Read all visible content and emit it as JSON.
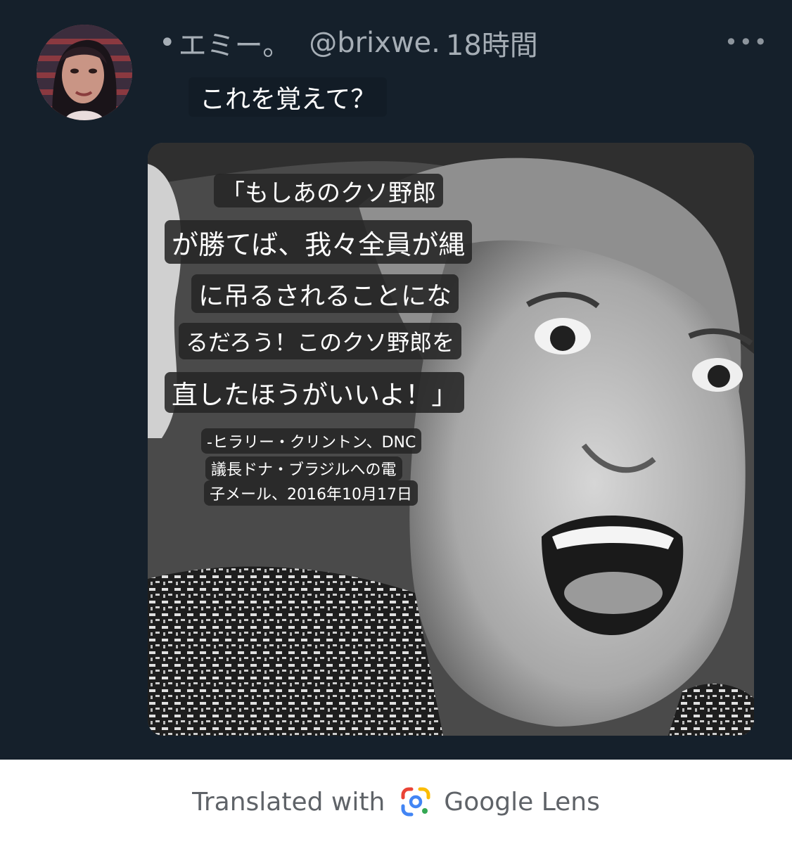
{
  "tweet": {
    "name_prefix": "•",
    "display_name": "エミー。",
    "handle": "@brixwe.",
    "time": "18時間",
    "more_label": "•••",
    "text": "これを覚えて？"
  },
  "media": {
    "quote_lines": [
      "「もしあのクソ野郎",
      "が勝てば、我々全員が縄",
      "に吊るされることにな",
      "るだろう！このクソ野郎を",
      "直したほうがいいよ！」"
    ],
    "attribution_lines": [
      "-ヒラリー・クリントン、DNC",
      "議長ドナ・ブラジルへの電",
      "子メール、2016年10月17日"
    ]
  },
  "footer": {
    "translated_with": "Translated with",
    "brand": "Google Lens"
  },
  "colors": {
    "background": "#15202b",
    "header_text": "#a6aeb6",
    "caption_bg": "#262626",
    "lens_blue": "#4285f4",
    "lens_red": "#ea4335",
    "lens_yellow": "#fbbc05",
    "lens_green": "#34a853"
  }
}
